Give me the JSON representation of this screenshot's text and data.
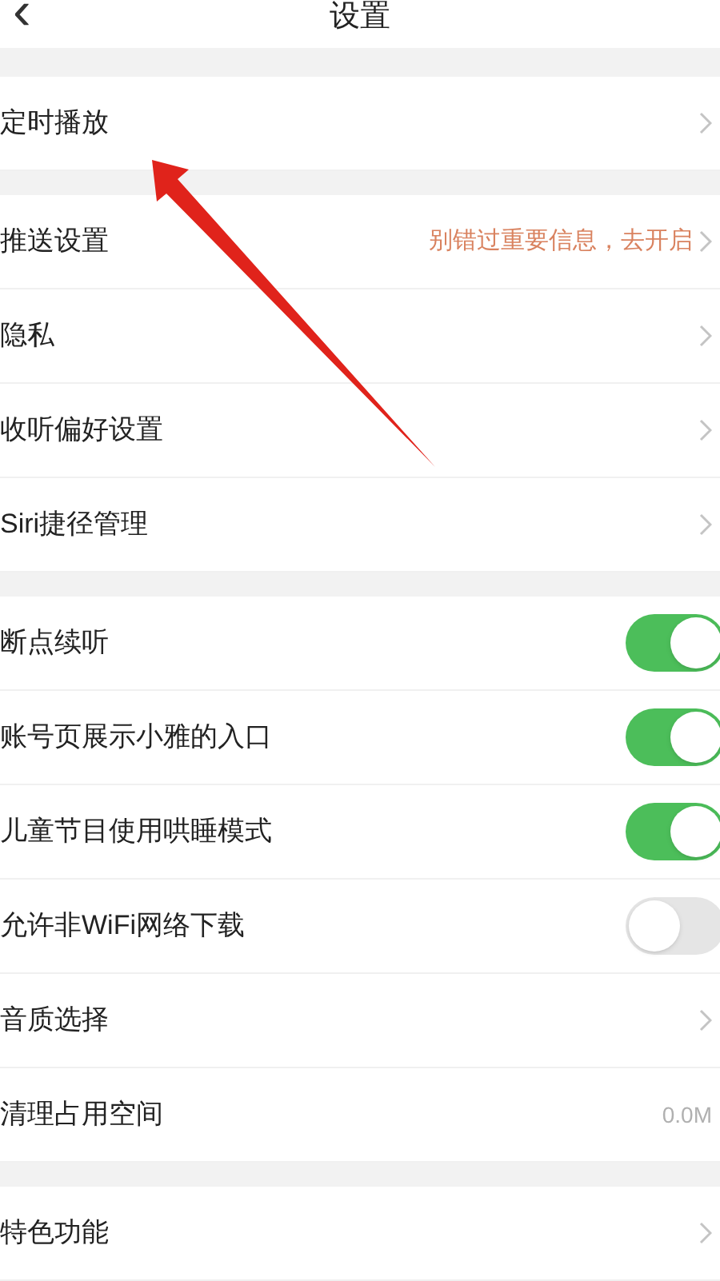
{
  "header": {
    "back_icon": "‹",
    "title": "设置"
  },
  "groups": [
    {
      "items": [
        {
          "kind": "link",
          "label": "定时播放"
        }
      ]
    },
    {
      "items": [
        {
          "kind": "link",
          "label": "推送设置",
          "hint": "别错过重要信息，去开启"
        },
        {
          "kind": "link",
          "label": "隐私"
        },
        {
          "kind": "link",
          "label": "收听偏好设置"
        },
        {
          "kind": "link",
          "label": "Siri捷径管理"
        }
      ]
    },
    {
      "items": [
        {
          "kind": "toggle",
          "label": "断点续听",
          "on": true
        },
        {
          "kind": "toggle",
          "label": "账号页展示小雅的入口",
          "on": true
        },
        {
          "kind": "toggle",
          "label": "儿童节目使用哄睡模式",
          "on": true
        },
        {
          "kind": "toggle",
          "label": "允许非WiFi网络下载",
          "on": false
        },
        {
          "kind": "link",
          "label": "音质选择"
        },
        {
          "kind": "value",
          "label": "清理占用空间",
          "value": "0.0M"
        }
      ]
    },
    {
      "items": [
        {
          "kind": "link",
          "label": "特色功能"
        }
      ]
    }
  ]
}
